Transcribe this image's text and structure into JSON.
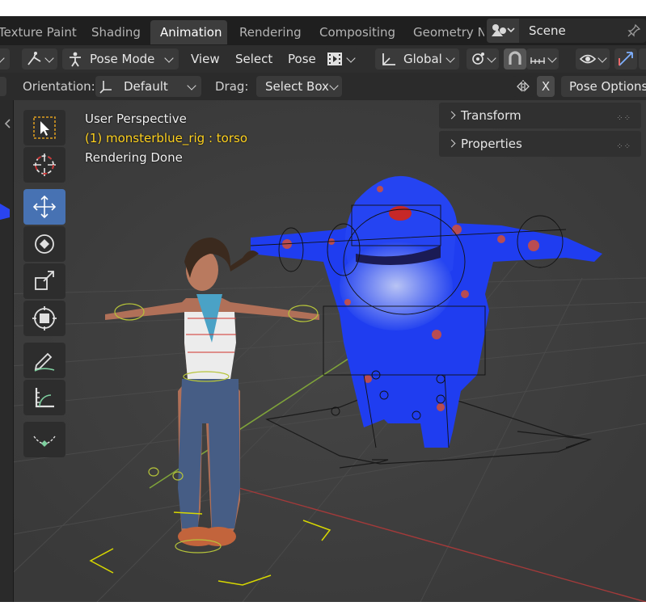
{
  "workspace_tabs": [
    {
      "label": "Texture Paint",
      "active": false
    },
    {
      "label": "Shading",
      "active": false
    },
    {
      "label": "Animation",
      "active": true
    },
    {
      "label": "Rendering",
      "active": false
    },
    {
      "label": "Compositing",
      "active": false
    },
    {
      "label": "Geometry N",
      "active": false
    }
  ],
  "scene": {
    "name": "Scene"
  },
  "header": {
    "mode_label": "Pose Mode",
    "menus": [
      "View",
      "Select",
      "Pose"
    ],
    "transform_orientation": "Global"
  },
  "tool_settings": {
    "orientation_label": "Orientation:",
    "orientation_value": "Default",
    "drag_label": "Drag:",
    "drag_value": "Select Box",
    "x_toggle": "X",
    "pose_options": "Pose Options"
  },
  "viewport": {
    "view_name": "User Perspective",
    "active_object": "(1) monsterblue_rig : torso",
    "status": "Rendering Done"
  },
  "toolbar_tools": [
    "select-box-tool",
    "cursor-tool",
    "move-tool",
    "rotate-tool",
    "scale-tool",
    "transform-tool",
    "annotate-tool",
    "measure-tool",
    "relax-pose-tool"
  ],
  "active_tool": "move-tool",
  "sidebar_panels": [
    {
      "label": "Transform"
    },
    {
      "label": "Properties"
    }
  ],
  "colors": {
    "accent": "#4772b3",
    "active_object_text": "#ffd21f",
    "viewport_bg": "#3d3d3d",
    "monster_body": "#1f3df0",
    "monster_spots": "#e0502a"
  }
}
